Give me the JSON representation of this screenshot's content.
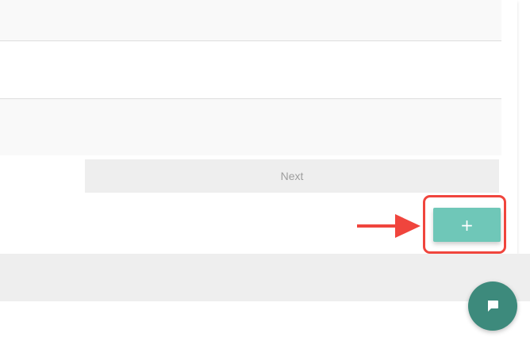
{
  "pagination": {
    "next_label": "Next"
  },
  "actions": {
    "add_label": "+"
  },
  "icons": {
    "arrow": "arrow-right-icon",
    "chat": "chat-bubble-icon"
  },
  "colors": {
    "accent": "#6fc7b8",
    "chat_fab": "#3d8a7c",
    "highlight": "#f0453d",
    "arrow": "#f0453d",
    "next_bg": "#eeeeee",
    "next_text": "#9e9e9e"
  }
}
